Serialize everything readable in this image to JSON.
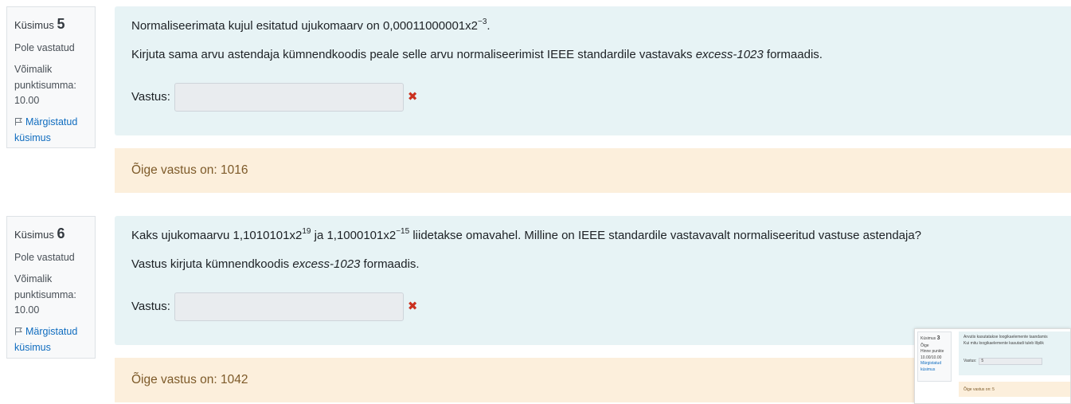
{
  "questions": [
    {
      "number_label": "Küsimus",
      "number": "5",
      "state": "Pole vastatud",
      "grade_label": "Võimalik punktisumma:",
      "grade_value": "10.00",
      "flag_label": "Märgistatud küsimus",
      "text1_prefix": "Normaliseerimata kujul esitatud ujukomaarv on 0,00011000001x2",
      "text1_exp": "−3",
      "text1_suffix": ".",
      "text2_prefix": "Kirjuta sama arvu astendaja kümnendkoodis peale selle arvu normaliseerimist IEEE standardile vastavaks ",
      "text2_italic": "excess-1023",
      "text2_suffix": " formaadis.",
      "answer_label": "Vastus:",
      "answer_value": "",
      "feedback": "Õige vastus on: 1016"
    },
    {
      "number_label": "Küsimus",
      "number": "6",
      "state": "Pole vastatud",
      "grade_label": "Võimalik punktisumma:",
      "grade_value": "10.00",
      "flag_label": "Märgistatud küsimus",
      "text1_a": "Kaks ujukomaarvu 1,1010101x2",
      "text1_exp_a": "19",
      "text1_b": " ja 1,1000101x2",
      "text1_exp_b": "−15",
      "text1_c": " liidetakse omavahel. Milline on IEEE standardile vastavavalt normaliseeritud vastuse astendaja?",
      "text2_prefix": "Vastus kirjuta kümnendkoodis ",
      "text2_italic": "excess-1023",
      "text2_suffix": " formaadis.",
      "answer_label": "Vastus:",
      "answer_value": "",
      "feedback": "Õige vastus on: 1042"
    }
  ],
  "thumbnail": {
    "number_label": "Küsimus",
    "number": "3",
    "state": "Õige",
    "grade": "Hinne punkte 10.00/10.00",
    "flag_label": "Märgistatud küsimus",
    "text_line1": "Arvutis kasutatakse loogikaelemente taandamis",
    "text_line2": "Kui mitu loogikaelemente kasutadi tuleb lõplik",
    "answer_label": "Vastus:",
    "answer_value": "5",
    "feedback": "Õige vastus on: 5"
  },
  "colors": {
    "question_bg": "#e7f3f5",
    "feedback_bg": "#fcefdc",
    "feedback_text": "#7d5a29",
    "link": "#0f6cbf",
    "incorrect_mark": "#ca3120"
  }
}
